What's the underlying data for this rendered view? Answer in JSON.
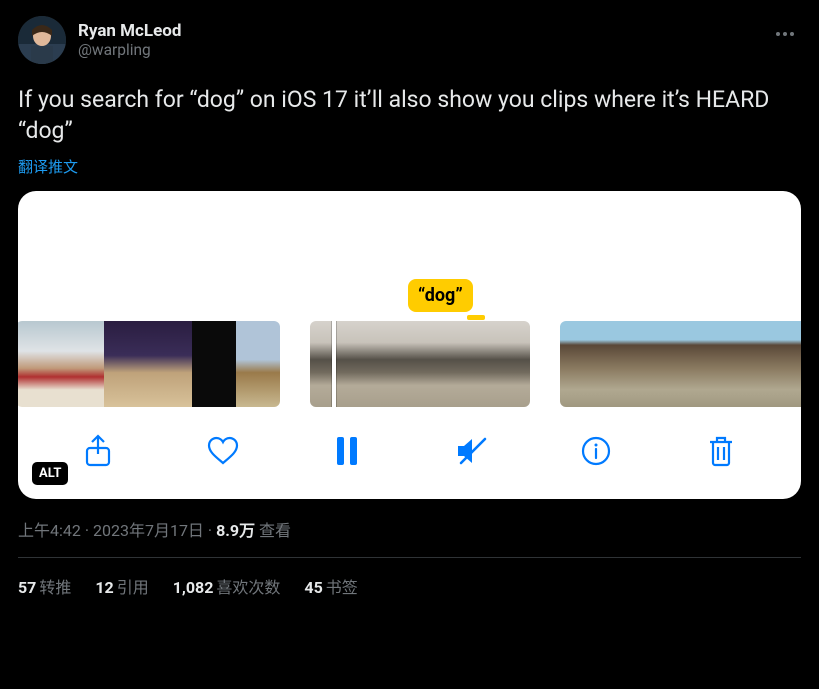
{
  "author": {
    "name": "Ryan McLeod",
    "handle": "@warpling"
  },
  "tweet_text": "If you search for “dog” on iOS 17 it’ll also show you clips where it’s HEARD “dog”",
  "translate_label": "翻译推文",
  "media": {
    "tag_text": "“dog”",
    "alt_badge": "ALT",
    "toolbar": {
      "share_icon": "share-icon",
      "like_icon": "heart-icon",
      "pause_icon": "pause-icon",
      "mute_icon": "speaker-mute-icon",
      "info_icon": "info-icon",
      "trash_icon": "trash-icon"
    }
  },
  "meta": {
    "time": "上午4:42",
    "sep": " · ",
    "date": "2023年7月17日",
    "views_count": "8.9万",
    "views_label": " 查看"
  },
  "stats": {
    "retweets_count": "57",
    "retweets_label": "转推",
    "quotes_count": "12",
    "quotes_label": "引用",
    "likes_count": "1,082",
    "likes_label": "喜欢次数",
    "bookmarks_count": "45",
    "bookmarks_label": "书签"
  }
}
